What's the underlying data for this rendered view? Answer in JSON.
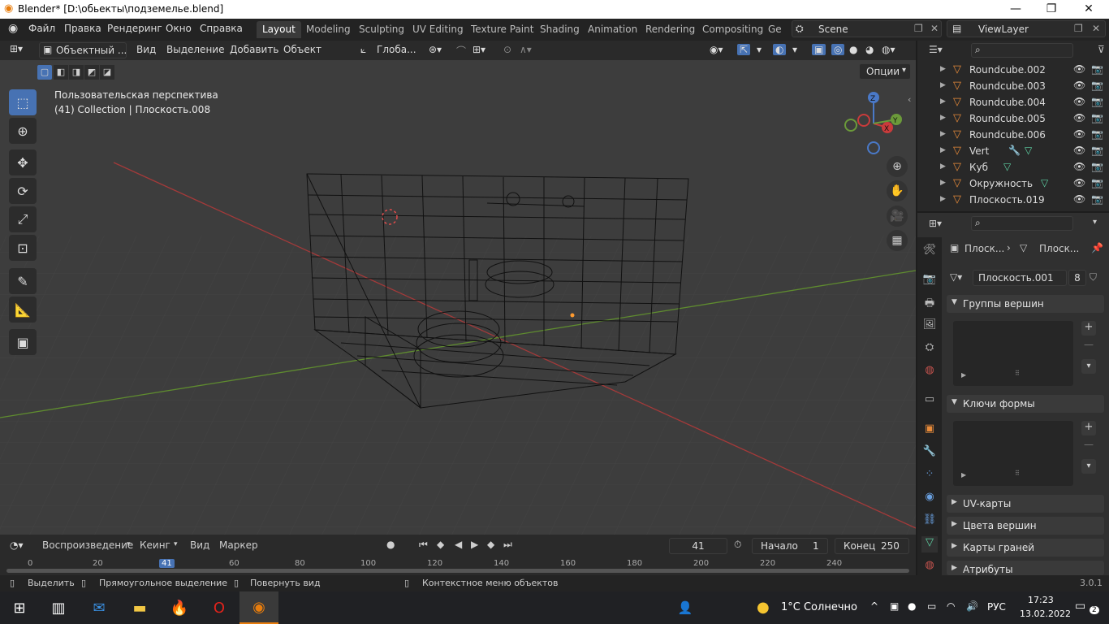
{
  "window": {
    "title": "Blender* [D:\\обьекты\\подземелье.blend]",
    "min": "—",
    "max": "❐",
    "close": "✕"
  },
  "menu": [
    "Файл",
    "Правка",
    "Рендеринг",
    "Окно",
    "Справка"
  ],
  "workspaces": [
    "Layout",
    "Modeling",
    "Sculpting",
    "UV Editing",
    "Texture Paint",
    "Shading",
    "Animation",
    "Rendering",
    "Compositing",
    "Ge"
  ],
  "scene": {
    "name": "Scene",
    "view_layer": "ViewLayer"
  },
  "viewport_header": {
    "mode": "Объектный ...",
    "items": [
      "Вид",
      "Выделение",
      "Добавить",
      "Объект"
    ],
    "transform": "Глоба...",
    "options": "Опции"
  },
  "viewport_info": {
    "line1": "Пользовательская перспектива",
    "line2": "(41) Collection | Плоскость.008"
  },
  "gizmo": {
    "z": "Z",
    "y": "Y",
    "x": "X"
  },
  "outliner": [
    {
      "name": "Roundcube.002"
    },
    {
      "name": "Roundcube.003"
    },
    {
      "name": "Roundcube.004"
    },
    {
      "name": "Roundcube.005"
    },
    {
      "name": "Roundcube.006"
    },
    {
      "name": "Vert"
    },
    {
      "name": "Куб"
    },
    {
      "name": "Окружность"
    },
    {
      "name": "Плоскость.019"
    }
  ],
  "properties": {
    "breadcrumb1": "Плоск...",
    "breadcrumb2": "Плоск...",
    "mesh_name": "Плоскость.001",
    "users": "8",
    "panels": [
      "Группы вершин",
      "Ключи формы",
      "UV-карты",
      "Цвета вершин",
      "Карты граней",
      "Атрибуты"
    ]
  },
  "timeline": {
    "playback": "Воспроизведение",
    "keying": "Кеинг",
    "view": "Вид",
    "marker": "Маркер",
    "current_frame": "41",
    "start_label": "Начало",
    "start": "1",
    "end_label": "Конец",
    "end": "250",
    "ruler": [
      "0",
      "20",
      "41",
      "60",
      "80",
      "100",
      "120",
      "140",
      "160",
      "180",
      "200",
      "220",
      "240"
    ]
  },
  "statusbar": {
    "select": "Выделить",
    "box_select": "Прямоугольное выделение",
    "rotate": "Повернуть вид",
    "context": "Контекстное меню объектов",
    "version": "3.0.1"
  },
  "taskbar": {
    "weather": "1°C Солнечно",
    "lang": "РУС",
    "time": "17:23",
    "date": "13.02.2022",
    "notif": "2"
  },
  "colors": {
    "accent": "#4772b3",
    "object": "#e88b3a",
    "mesh": "#5fd3a5",
    "x_axis": "#c93b3b",
    "y_axis": "#6b9a3a"
  }
}
